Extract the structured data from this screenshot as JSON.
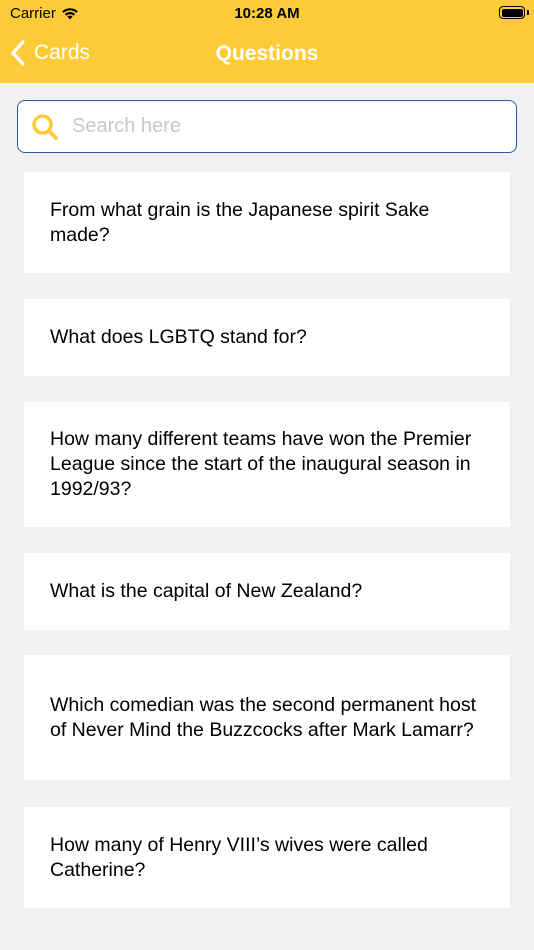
{
  "status_bar": {
    "carrier": "Carrier",
    "time": "10:28 AM"
  },
  "nav": {
    "back_label": "Cards",
    "title": "Questions"
  },
  "search": {
    "placeholder": "Search here",
    "value": ""
  },
  "questions": [
    "From what grain is the Japanese spirit Sake made?",
    "What does LGBTQ stand for?",
    "How many different teams have won the Premier League since the start of the inaugural season in 1992/93?",
    "What is the capital of New Zealand?",
    "Which comedian was the second permanent host of Never Mind the Buzzcocks after Mark Lamarr?",
    "How many of Henry VIII’s wives were called Catherine?"
  ],
  "colors": {
    "header": "#fdcb37",
    "background": "#f1f1f1",
    "search_border": "#2b5a9e",
    "search_icon": "#fdcb37"
  },
  "icons": {
    "wifi": "wifi-icon",
    "battery": "battery-icon",
    "back": "chevron-left-icon",
    "search": "search-icon"
  }
}
